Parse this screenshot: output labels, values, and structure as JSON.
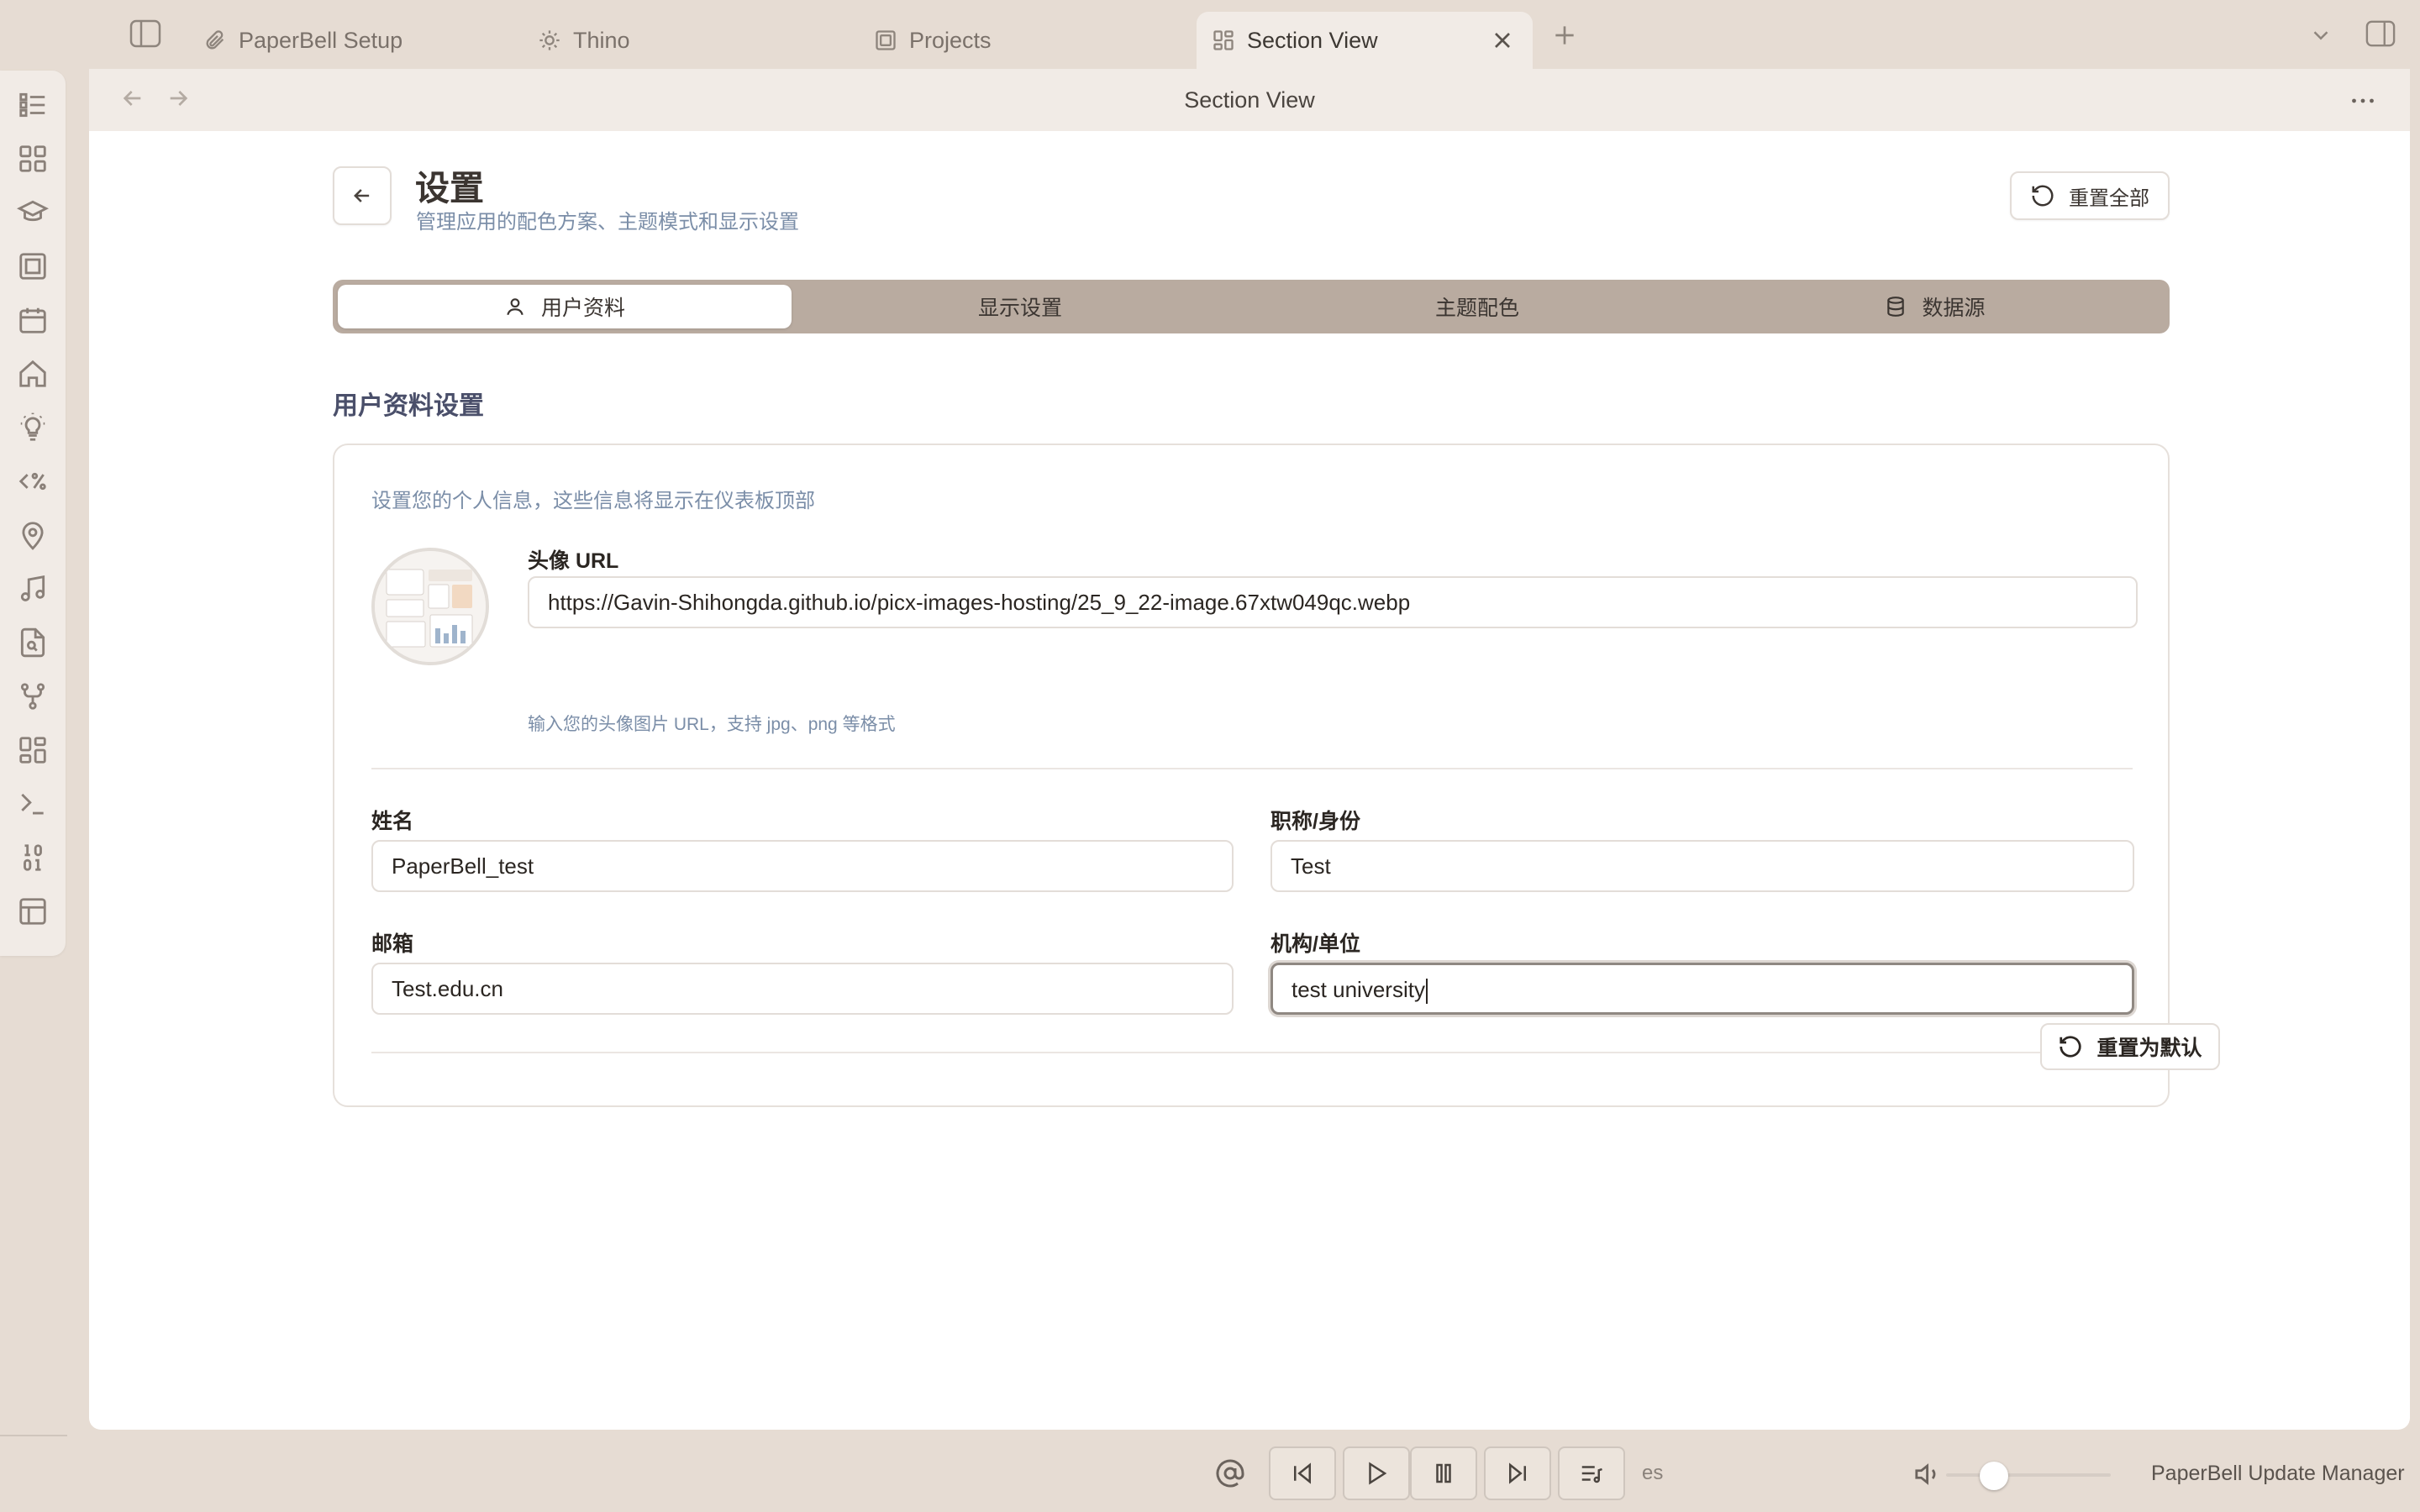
{
  "tabs": [
    {
      "label": "PaperBell Setup",
      "icon": "paperclip-icon"
    },
    {
      "label": "Thino",
      "icon": "sun-icon"
    },
    {
      "label": "Projects",
      "icon": "layers-icon"
    },
    {
      "label": "Section View",
      "icon": "dashboard-icon",
      "active": true
    }
  ],
  "view": {
    "title": "Section View"
  },
  "settings": {
    "title": "设置",
    "subtitle": "管理应用的配色方案、主题模式和显示设置",
    "reset_all_label": "重置全部"
  },
  "segments": [
    {
      "label": "用户资料",
      "icon": "user-icon",
      "active": true
    },
    {
      "label": "显示设置"
    },
    {
      "label": "主题配色"
    },
    {
      "label": "数据源",
      "icon": "database-icon"
    }
  ],
  "profile": {
    "section_title": "用户资料设置",
    "description": "设置您的个人信息，这些信息将显示在仪表板顶部",
    "avatar_label": "头像 URL",
    "avatar_url": "https://Gavin-Shihongda.github.io/picx-images-hosting/25_9_22-image.67xtw049qc.webp",
    "avatar_hint": "输入您的头像图片 URL，支持 jpg、png 等格式",
    "name_label": "姓名",
    "name_value": "PaperBell_test",
    "title_label": "职称/身份",
    "title_value": "Test",
    "email_label": "邮箱",
    "email_value": "Test.edu.cn",
    "org_label": "机构/单位",
    "org_value": "test university",
    "reset_default_label": "重置为默认"
  },
  "statusbar": {
    "plugin_label": "PaperBell Update Manager",
    "clipped_text": "es",
    "volume_level": 0.2
  },
  "colors": {
    "chrome_bg": "#e6dcd3",
    "tab_active_bg": "#f1ebe6",
    "segment_bg": "#b9aba0",
    "hint_blue": "#7b8ea8",
    "section_title": "#4a4f6a"
  }
}
